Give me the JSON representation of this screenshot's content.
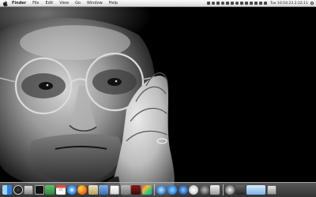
{
  "menubar": {
    "apple_icon": "apple-icon",
    "items": [
      "Finder",
      "File",
      "Edit",
      "View",
      "Go",
      "Window",
      "Help"
    ],
    "clock": "Tue 10:54:23 2:22:11"
  },
  "wallpaper": {
    "subject": "portrait-photo"
  },
  "dock": {
    "calendar_day": "17",
    "items": [
      {
        "icon": "finder-icon"
      },
      {
        "icon": "dashboard-icon"
      },
      {
        "icon": "system-monitor-icon"
      },
      {
        "icon": "terminal-icon"
      },
      {
        "icon": "preview-icon"
      },
      {
        "icon": "calendar-icon"
      },
      {
        "icon": "safari-icon"
      },
      {
        "icon": "firefox-icon"
      },
      {
        "icon": "mail-icon"
      },
      {
        "icon": "finder-window-icon"
      },
      {
        "icon": "textedit-icon"
      },
      {
        "icon": "preferences-icon"
      },
      {
        "icon": "photo-booth-icon"
      },
      {
        "icon": "aperture-icon"
      },
      {
        "icon": "itunes-icon"
      },
      {
        "icon": "app-store-icon"
      },
      {
        "icon": "quicktime-icon"
      },
      {
        "icon": "itunes-alt-icon"
      },
      {
        "icon": "gear-icon"
      },
      {
        "icon": "iphoto-icon"
      },
      {
        "icon": "dvd-player-icon"
      },
      {
        "icon": "time-machine-icon"
      },
      {
        "icon": "folder-icon"
      },
      {
        "icon": "trash-icon"
      }
    ]
  }
}
